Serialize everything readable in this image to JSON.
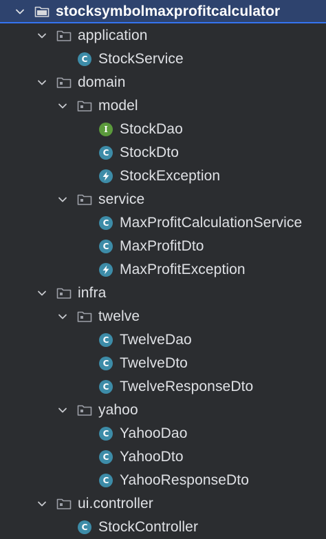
{
  "project_tree": {
    "root": {
      "label": "stocksymbolmaxprofitcalculator",
      "icon": "folder-icon",
      "expanded": true,
      "selected": true
    },
    "application": {
      "label": "application",
      "icon": "package-icon",
      "items": [
        {
          "label": "StockService",
          "icon": "class-icon",
          "badge": "C"
        }
      ]
    },
    "domain": {
      "label": "domain",
      "icon": "package-icon",
      "model": {
        "label": "model",
        "icon": "package-icon",
        "items": [
          {
            "label": "StockDao",
            "icon": "interface-icon",
            "badge": "I"
          },
          {
            "label": "StockDto",
            "icon": "class-icon",
            "badge": "C"
          },
          {
            "label": "StockException",
            "icon": "exception-icon"
          }
        ]
      },
      "service": {
        "label": "service",
        "icon": "package-icon",
        "items": [
          {
            "label": "MaxProfitCalculationService",
            "icon": "class-icon",
            "badge": "C"
          },
          {
            "label": "MaxProfitDto",
            "icon": "class-icon",
            "badge": "C"
          },
          {
            "label": "MaxProfitException",
            "icon": "exception-icon"
          }
        ]
      }
    },
    "infra": {
      "label": "infra",
      "icon": "package-icon",
      "twelve": {
        "label": "twelve",
        "icon": "package-icon",
        "items": [
          {
            "label": "TwelveDao",
            "icon": "class-icon",
            "badge": "C"
          },
          {
            "label": "TwelveDto",
            "icon": "class-icon",
            "badge": "C"
          },
          {
            "label": "TwelveResponseDto",
            "icon": "class-icon",
            "badge": "C"
          }
        ]
      },
      "yahoo": {
        "label": "yahoo",
        "icon": "package-icon",
        "items": [
          {
            "label": "YahooDao",
            "icon": "class-icon",
            "badge": "C"
          },
          {
            "label": "YahooDto",
            "icon": "class-icon",
            "badge": "C"
          },
          {
            "label": "YahooResponseDto",
            "icon": "class-icon",
            "badge": "C"
          }
        ]
      }
    },
    "ui_controller": {
      "label": "ui.controller",
      "icon": "package-icon",
      "items": [
        {
          "label": "StockController",
          "icon": "class-icon",
          "badge": "C"
        }
      ]
    }
  },
  "colors": {
    "background": "#2b2d30",
    "selection": "#2e436e",
    "selection_border": "#3574f0",
    "text": "#dfe1e5",
    "folder": "#9da0a8",
    "class_badge": "#3d8ca8",
    "interface_badge": "#5b9a3c"
  }
}
